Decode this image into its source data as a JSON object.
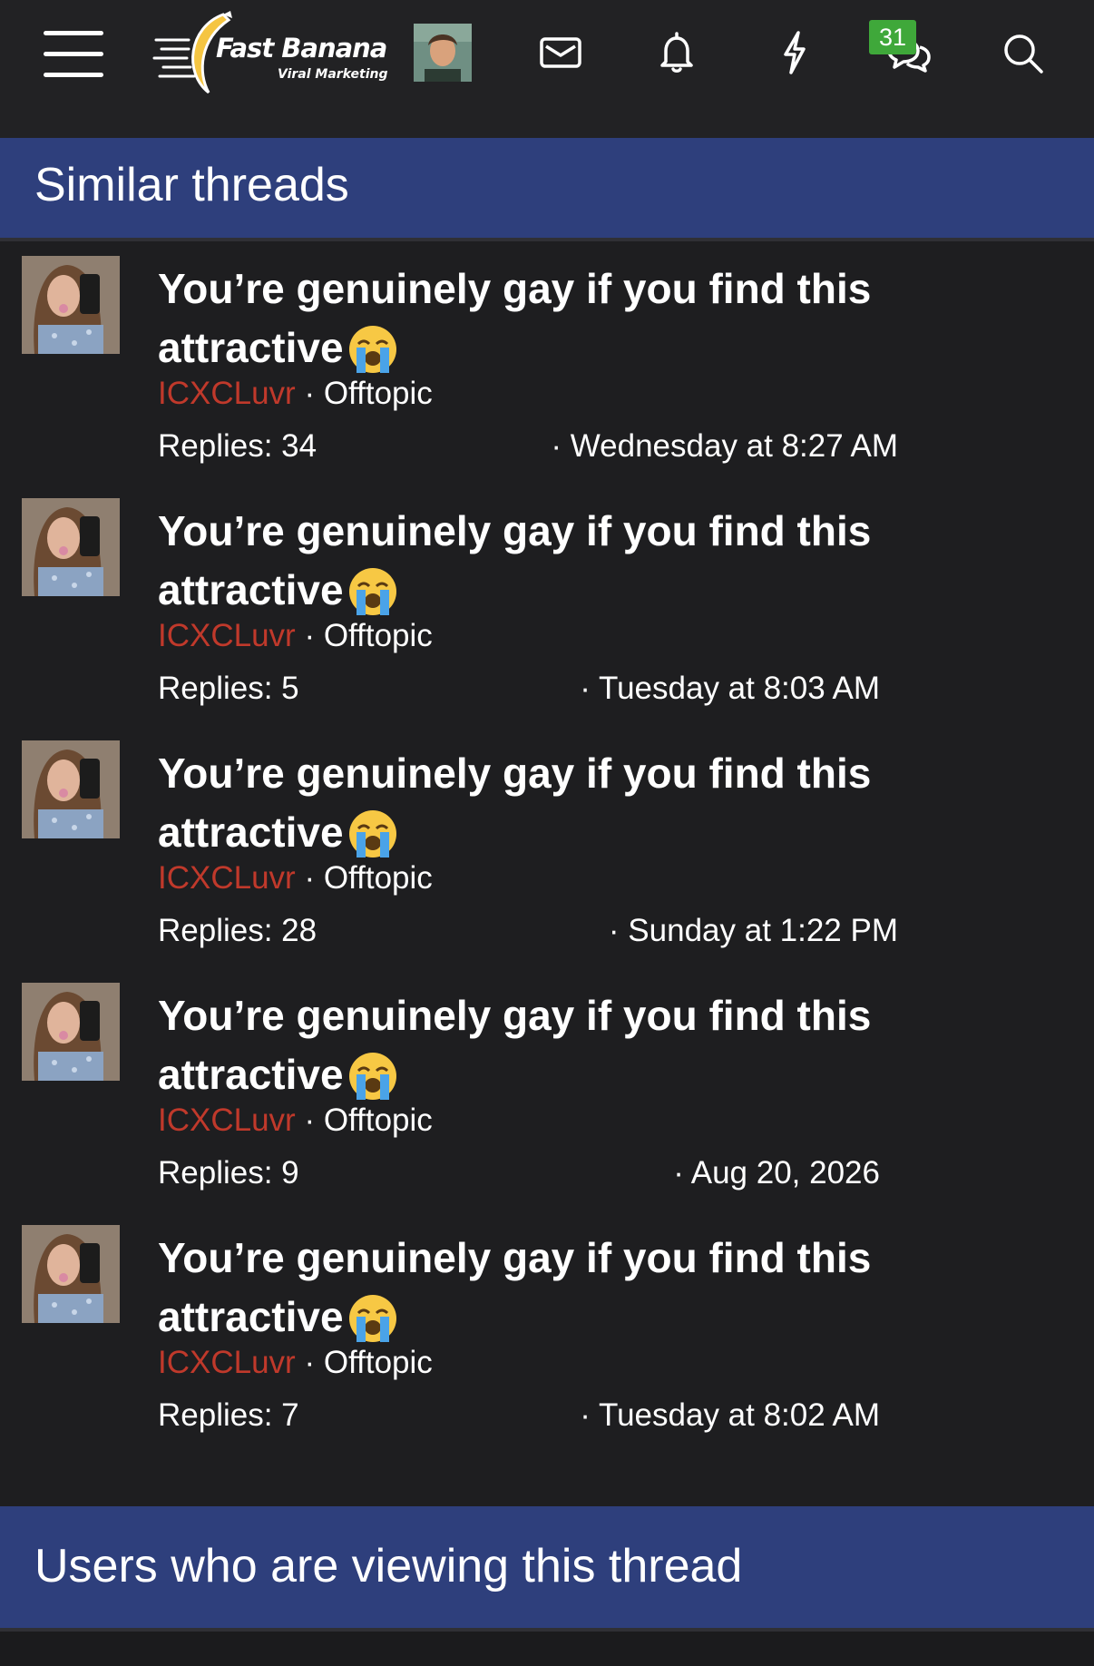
{
  "header": {
    "logo_title": "Fast Banana",
    "logo_subtitle": "Viral Marketing",
    "alerts_badge": "31",
    "icons": [
      "menu-icon",
      "envelope-icon",
      "bell-icon",
      "lightning-icon",
      "chat-bubbles-icon",
      "search-icon"
    ]
  },
  "similar_threads": {
    "heading": "Similar threads",
    "threads": [
      {
        "title": "You’re genuinely gay if you find this attractive",
        "author": "ICXCLuvr",
        "separator": " · ",
        "forum": "Offtopic",
        "replies": "Replies: 34",
        "date": "· Wednesday at 8:27 AM"
      },
      {
        "title": "You’re genuinely gay if you find this attractive",
        "author": "ICXCLuvr",
        "separator": " · ",
        "forum": "Offtopic",
        "replies": "Replies: 5",
        "date": "· Tuesday at 8:03 AM"
      },
      {
        "title": "You’re genuinely gay if you find this attractive",
        "author": "ICXCLuvr",
        "separator": " · ",
        "forum": "Offtopic",
        "replies": "Replies: 28",
        "date": "· Sunday at 1:22 PM"
      },
      {
        "title": "You’re genuinely gay if you find this attractive",
        "author": "ICXCLuvr",
        "separator": " · ",
        "forum": "Offtopic",
        "replies": "Replies: 9",
        "date": "· Aug 20, 2026"
      },
      {
        "title": "You’re genuinely gay if you find this attractive",
        "author": "ICXCLuvr",
        "separator": " · ",
        "forum": "Offtopic",
        "replies": "Replies: 7",
        "date": "· Tuesday at 8:02 AM"
      }
    ]
  },
  "viewers": {
    "heading": "Users who are viewing this thread"
  },
  "colors": {
    "background": "#1e1e20",
    "topbar": "#222224",
    "section_header": "#2e3f7c",
    "author_link": "#c0392b",
    "badge": "#3fa83a",
    "logo_banana": "#f5c542"
  }
}
